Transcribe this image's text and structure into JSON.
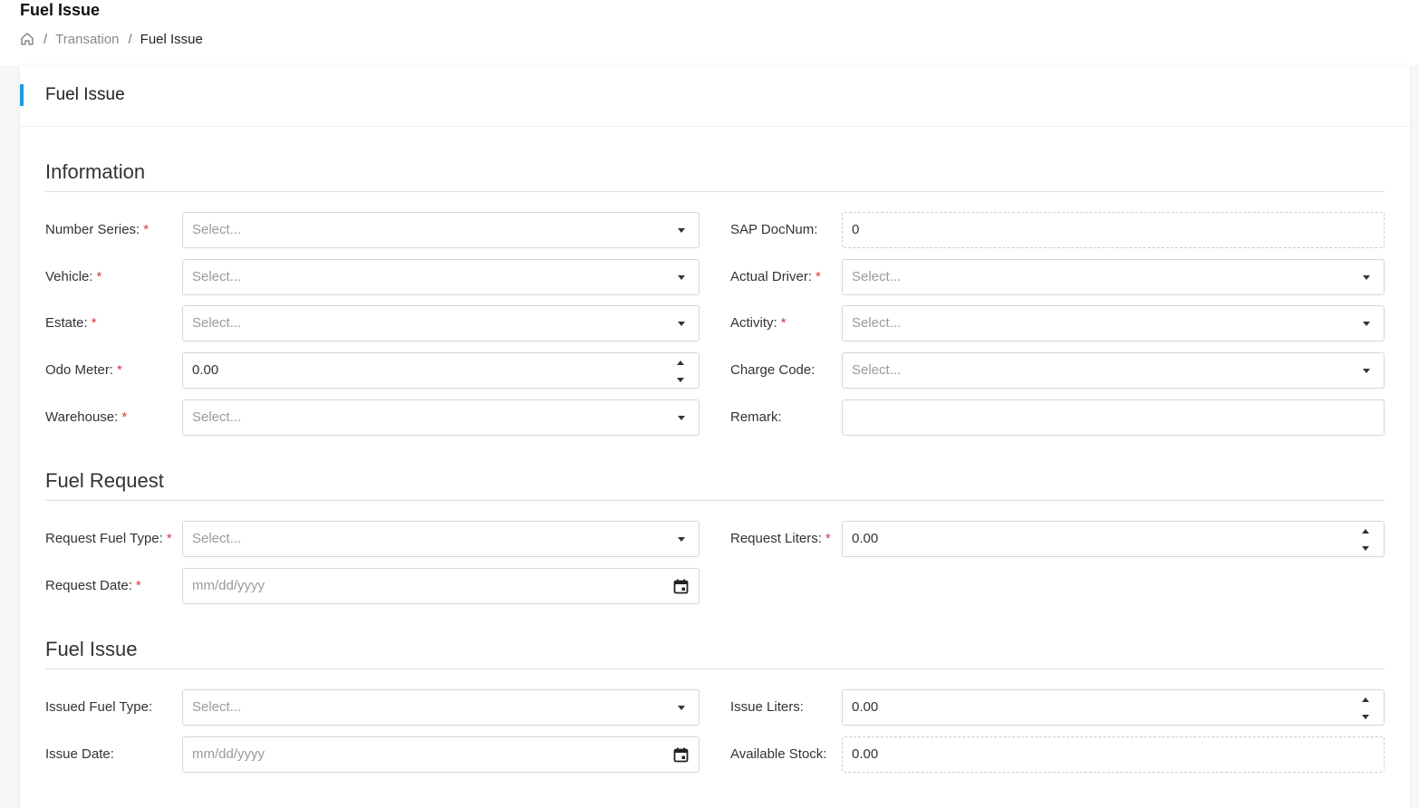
{
  "page": {
    "title": "Fuel Issue",
    "breadcrumb": [
      "Transation",
      "Fuel Issue"
    ],
    "breadcrumb_separator": "/"
  },
  "card": {
    "title": "Fuel Issue",
    "accent_color": "#1e9be0"
  },
  "required_mark": "*",
  "sections": {
    "information": {
      "title": "Information",
      "number_series": {
        "label": "Number Series:",
        "placeholder": "Select..."
      },
      "vehicle": {
        "label": "Vehicle:",
        "placeholder": "Select..."
      },
      "estate": {
        "label": "Estate:",
        "placeholder": "Select..."
      },
      "odo_meter": {
        "label": "Odo Meter:",
        "value": "0.00"
      },
      "warehouse": {
        "label": "Warehouse:",
        "placeholder": "Select..."
      },
      "sap_docnum": {
        "label": "SAP DocNum:",
        "value": "0"
      },
      "actual_driver": {
        "label": "Actual Driver:",
        "placeholder": "Select..."
      },
      "activity": {
        "label": "Activity:",
        "placeholder": "Select..."
      },
      "charge_code": {
        "label": "Charge Code:",
        "placeholder": "Select..."
      },
      "remark": {
        "label": "Remark:",
        "value": ""
      }
    },
    "fuel_request": {
      "title": "Fuel Request",
      "request_fuel_type": {
        "label": "Request Fuel Type:",
        "placeholder": "Select..."
      },
      "request_date": {
        "label": "Request Date:",
        "placeholder": "mm/dd/yyyy"
      },
      "request_liters": {
        "label": "Request Liters:",
        "value": "0.00"
      }
    },
    "fuel_issue": {
      "title": "Fuel Issue",
      "issued_fuel_type": {
        "label": "Issued Fuel Type:",
        "placeholder": "Select..."
      },
      "issue_date": {
        "label": "Issue Date:",
        "placeholder": "mm/dd/yyyy"
      },
      "issue_liters": {
        "label": "Issue Liters:",
        "value": "0.00"
      },
      "available_stock": {
        "label": "Available Stock:",
        "value": "0.00"
      }
    }
  }
}
